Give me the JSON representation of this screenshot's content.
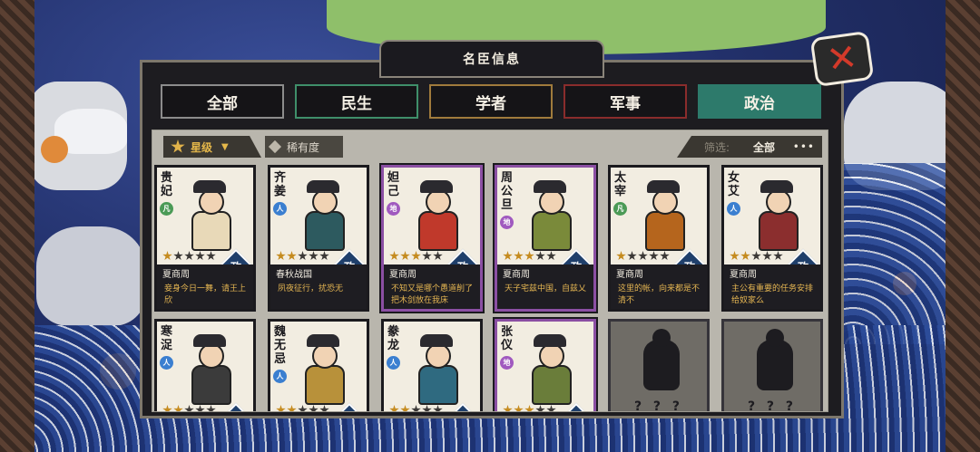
{
  "title": "名臣信息",
  "tabs": [
    {
      "label": "全部",
      "key": "all"
    },
    {
      "label": "民生",
      "key": "min"
    },
    {
      "label": "学者",
      "key": "xue"
    },
    {
      "label": "军事",
      "key": "jun"
    },
    {
      "label": "政治",
      "key": "zheng",
      "active": true
    }
  ],
  "toolbar": {
    "sort_star_label": "星级",
    "sort_star_arrow": "▼",
    "sort_rare_label": "稀有度",
    "filter_label": "筛选:",
    "filter_value": "全部",
    "more": "•••"
  },
  "type_badge": "政",
  "locked_mark": "? ? ?",
  "cards": [
    {
      "name": "贵妃",
      "rank": "凡",
      "rank_type": "fan",
      "stars": 1,
      "era": "夏商周",
      "quote": "妾身今日一舞，请王上欣",
      "purple": false,
      "color": "#e8d9b8"
    },
    {
      "name": "齐姜",
      "rank": "人",
      "rank_type": "ren",
      "stars": 2,
      "era": "春秋战国",
      "quote": "夙夜征行，扰恐无",
      "purple": false,
      "color": "#2d5a5f"
    },
    {
      "name": "妲己",
      "rank": "地",
      "rank_type": "di",
      "stars": 3,
      "era": "夏商周",
      "quote": "不知又是哪个愚道削了把木剑放在我床",
      "purple": true,
      "color": "#c0392b"
    },
    {
      "name": "周公旦",
      "rank": "地",
      "rank_type": "di",
      "stars": 3,
      "era": "夏商周",
      "quote": "天子宅兹中国，自兹乂",
      "purple": true,
      "color": "#7a8a3a"
    },
    {
      "name": "太宰",
      "rank": "凡",
      "rank_type": "fan",
      "stars": 1,
      "era": "夏商周",
      "quote": "这里的帐，向来都是不清不",
      "purple": false,
      "color": "#b5651d"
    },
    {
      "name": "女艾",
      "rank": "人",
      "rank_type": "ren",
      "stars": 2,
      "era": "夏商周",
      "quote": "主公有重要的任务安排给奴家么",
      "purple": false,
      "color": "#8b2e2e"
    },
    {
      "name": "寒浞",
      "rank": "人",
      "rank_type": "ren",
      "stars": 2,
      "era": "",
      "quote": "",
      "purple": false,
      "color": "#3b3b3b"
    },
    {
      "name": "魏无忌",
      "rank": "人",
      "rank_type": "ren",
      "stars": 2,
      "era": "",
      "quote": "",
      "purple": false,
      "color": "#b8913a"
    },
    {
      "name": "豢龙",
      "rank": "人",
      "rank_type": "ren",
      "stars": 2,
      "era": "",
      "quote": "",
      "purple": false,
      "color": "#2f6a80"
    },
    {
      "name": "张仪",
      "rank": "地",
      "rank_type": "di",
      "stars": 3,
      "era": "",
      "quote": "",
      "purple": true,
      "color": "#6a7d3a"
    },
    {
      "locked": true
    },
    {
      "locked": true
    }
  ]
}
